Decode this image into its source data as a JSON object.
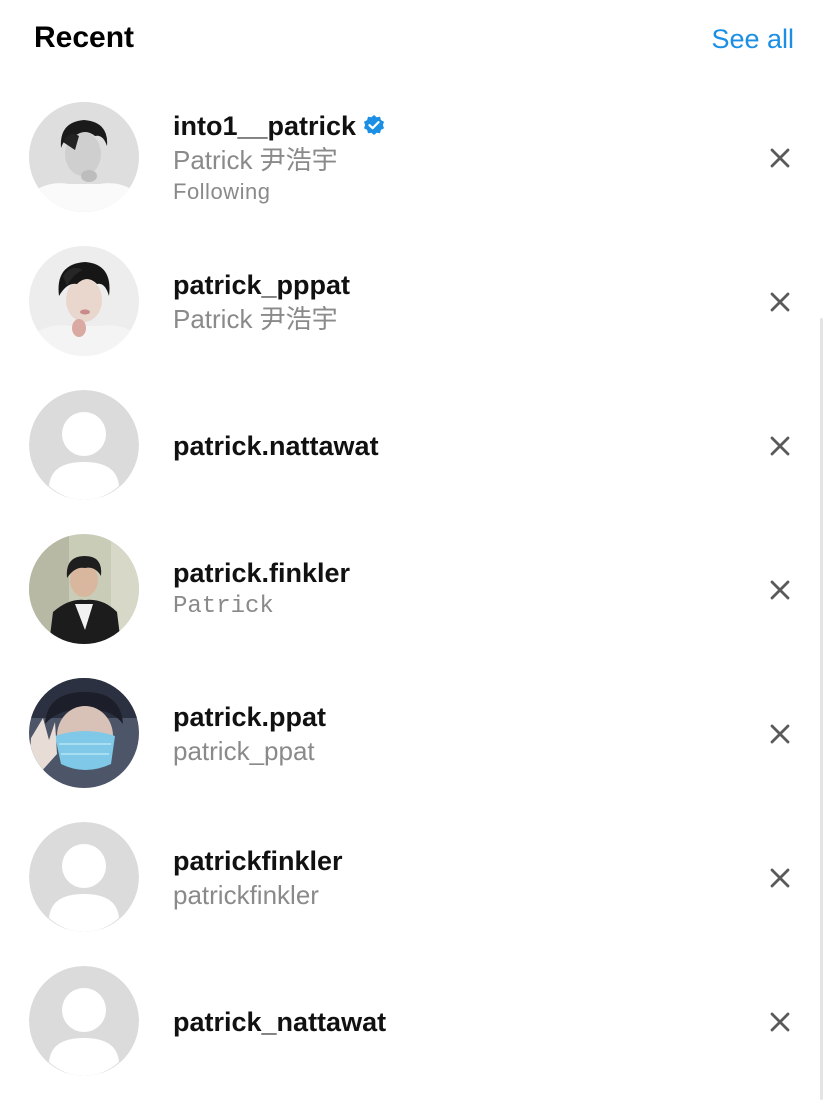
{
  "header": {
    "title": "Recent",
    "see_all": "See all"
  },
  "colors": {
    "accent": "#1a8fe3",
    "secondary_text": "#8a8a8a",
    "verified_badge": "#1a8fe3",
    "placeholder_avatar": "#dbdbdb"
  },
  "items": [
    {
      "username": "into1__patrick",
      "verified": true,
      "fullname": "Patrick 尹浩宇",
      "status": "Following",
      "avatar": "photo-bw-portrait"
    },
    {
      "username": "patrick_pppat",
      "verified": false,
      "fullname": "Patrick 尹浩宇",
      "status": "",
      "avatar": "photo-portrait"
    },
    {
      "username": "patrick.nattawat",
      "verified": false,
      "fullname": "",
      "status": "",
      "avatar": "default-placeholder"
    },
    {
      "username": "patrick.finkler",
      "verified": false,
      "fullname": "Patrick",
      "status": "",
      "avatar": "photo-jacket"
    },
    {
      "username": "patrick.ppat",
      "verified": false,
      "fullname": "patrick_ppat",
      "status": "",
      "avatar": "photo-mask"
    },
    {
      "username": "patrickfinkler",
      "verified": false,
      "fullname": "patrickfinkler",
      "status": "",
      "avatar": "default-placeholder"
    },
    {
      "username": "patrick_nattawat",
      "verified": false,
      "fullname": "",
      "status": "",
      "avatar": "default-placeholder"
    }
  ],
  "icons": {
    "remove": "close-icon",
    "verified": "verified-badge-icon"
  }
}
